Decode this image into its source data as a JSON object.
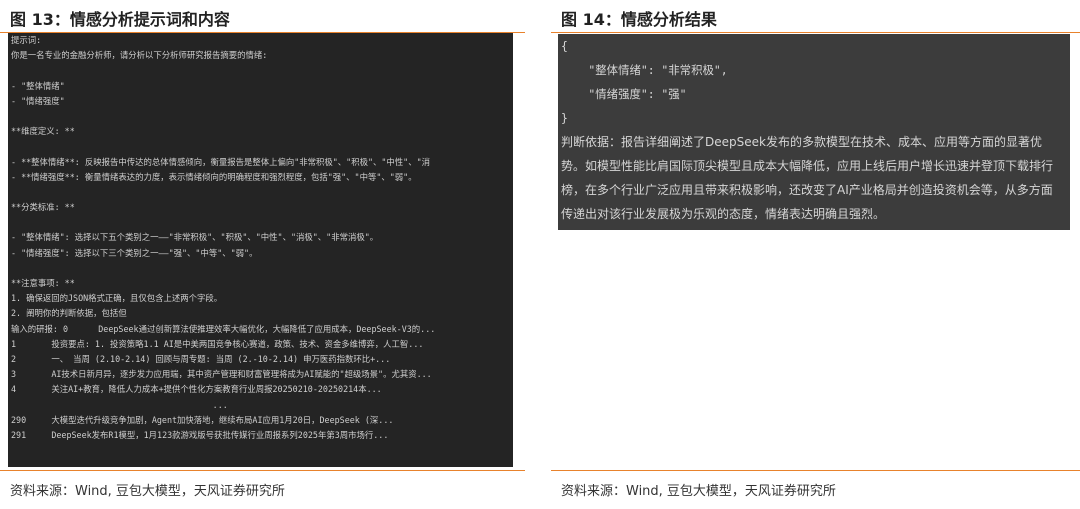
{
  "left": {
    "title": "图 13：情感分析提示词和内容",
    "source": "资料来源：Wind, 豆包大模型，天风证券研究所",
    "lines": [
      "提示词:",
      "你是一名专业的金融分析师，请分析以下分析师研究报告摘要的情绪:",
      "",
      "- \"整体情绪\"",
      "- \"情绪强度\"",
      "",
      "**维度定义: **",
      "",
      "- **整体情绪**: 反映报告中传达的总体情感倾向，衡量报告是整体上偏向\"非常积极\"、\"积极\"、\"中性\"、\"消",
      "- **情绪强度**: 衡量情绪表达的力度，表示情绪倾向的明确程度和强烈程度，包括\"强\"、\"中等\"、\"弱\"。",
      "",
      "**分类标准: **",
      "",
      "- \"整体情绪\": 选择以下五个类别之一——\"非常积极\"、\"积极\"、\"中性\"、\"消极\"、\"非常消极\"。",
      "- \"情绪强度\": 选择以下三个类别之一——\"强\"、\"中等\"、\"弱\"。",
      "",
      "**注意事项: **",
      "1. 确保返回的JSON格式正确，且仅包含上述两个字段。",
      "2. 阐明你的判断依据，包括但",
      "输入的研报: 0      DeepSeek通过创新算法使推理效率大幅优化，大幅降低了应用成本，DeepSeek-V3的...",
      "1       投资要点: 1. 投资策略1.1 AI是中美两国竞争核心赛道，政策、技术、资金多维博弈，人工智...",
      "2       一、 当周 (2.10-2.14) 回顾与周专题: 当周 (2.-10-2.14) 申万医药指数环比+...",
      "3       AI技术日新月异，逐步发力应用端，其中资产管理和财富管理将成为AI赋能的\"超级场景\"。尤其资...",
      "4       关注AI+教育，降低人力成本+提供个性化方案教育行业周报20250210-20250214本...",
      "                                        ...",
      "290     大模型迭代升级竞争加剧，Agent加快落地，继续布局AI应用1月20日，DeepSeek (深...",
      "291     DeepSeek发布R1模型，1月123款游戏版号获批传媒行业周报系列2025年第3周市场行..."
    ]
  },
  "right": {
    "title": "图 14：情感分析结果",
    "source": "资料来源：Wind, 豆包大模型，天风证券研究所",
    "json_lines": [
      "{",
      "    \"整体情绪\": \"非常积极\",",
      "    \"情绪强度\": \"强\"",
      "}"
    ],
    "basis": "判断依据：报告详细阐述了DeepSeek发布的多款模型在技术、成本、应用等方面的显著优势。如模型性能比肩国际顶尖模型且成本大幅降低，应用上线后用户增长迅速并登顶下载排行榜，在多个行业广泛应用且带来积极影响，还改变了AI产业格局并创造投资机会等，从多方面传递出对该行业发展极为乐观的态度，情绪表达明确且强烈。"
  },
  "colors": {
    "accent_rule": "#e8822c",
    "terminal_bg": "#242424",
    "result_bg": "#3c3c3c"
  }
}
